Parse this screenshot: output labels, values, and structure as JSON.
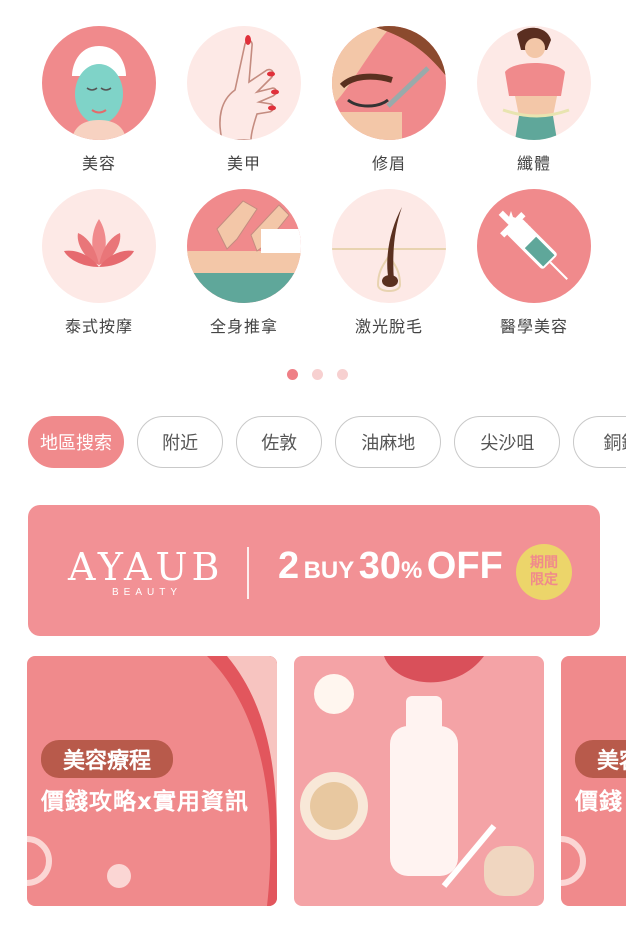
{
  "categories": [
    {
      "label": "美容",
      "icon": "face-mask-icon"
    },
    {
      "label": "美甲",
      "icon": "manicure-hand-icon"
    },
    {
      "label": "修眉",
      "icon": "eyebrow-icon"
    },
    {
      "label": "纖體",
      "icon": "slimming-body-icon"
    },
    {
      "label": "泰式按摩",
      "icon": "lotus-icon"
    },
    {
      "label": "全身推拿",
      "icon": "massage-icon"
    },
    {
      "label": "激光脫毛",
      "icon": "hair-follicle-icon"
    },
    {
      "label": "醫學美容",
      "icon": "syringe-icon"
    }
  ],
  "pagination": {
    "pages": 3,
    "active": 0
  },
  "chips": [
    "地區搜索",
    "附近",
    "佐敦",
    "油麻地",
    "尖沙咀",
    "銅鑼"
  ],
  "banner": {
    "brand": "AYAUB",
    "brand_sub": "BEAUTY",
    "offer_a": "2",
    "offer_b": "BUY",
    "offer_c": "30",
    "offer_d": "%",
    "offer_e": "OFF",
    "badge": "期間限定"
  },
  "cards": [
    {
      "tag": "美容療程",
      "subtitle": "價錢攻略x實用資訊"
    },
    {
      "tag": "",
      "subtitle": ""
    },
    {
      "tag": "美容",
      "subtitle": "價錢"
    }
  ],
  "colors": {
    "accent": "#f08a8c",
    "banner": "#f29195",
    "badge": "#ecd56a",
    "pill": "#b85a4b"
  }
}
